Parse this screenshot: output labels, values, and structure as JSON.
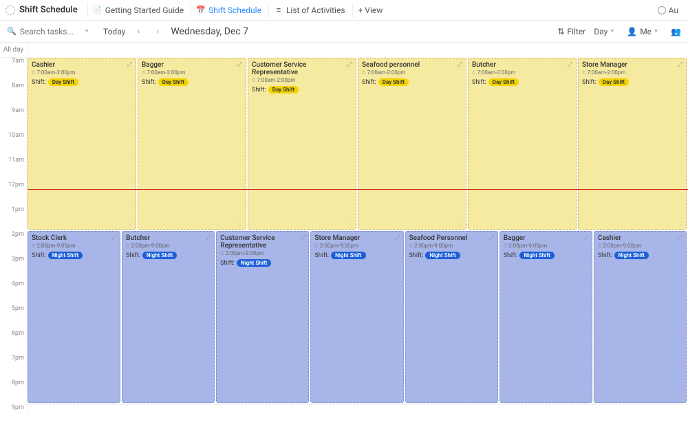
{
  "header": {
    "title": "Shift Schedule",
    "tabs": [
      {
        "label": "Getting Started Guide",
        "icon": "📄"
      },
      {
        "label": "Shift Schedule",
        "icon": "📅",
        "active": true
      },
      {
        "label": "List of Activities",
        "icon": "≡"
      }
    ],
    "addView": "+ View",
    "auBtn": "Au"
  },
  "controls": {
    "searchPlaceholder": "Search tasks...",
    "today": "Today",
    "date": "Wednesday, Dec 7",
    "filter": "Filter",
    "dayView": "Day",
    "me": "Me"
  },
  "calendar": {
    "allDay": "All day",
    "hours": [
      "7am",
      "8am",
      "9am",
      "10am",
      "11am",
      "12pm",
      "1pm",
      "2pm",
      "3pm",
      "4pm",
      "5pm",
      "6pm",
      "7pm",
      "8pm",
      "9pm"
    ],
    "startHour": 7,
    "hourHeight": 36,
    "nowHour": 12.3,
    "shiftLabel": "Shift:",
    "dayBadge": "Day Shift",
    "nightBadge": "Night Shift",
    "dayTime": "7:00am-2:00pm",
    "nightTime": "2:00pm-9:00pm",
    "dayEvents": [
      {
        "title": "Cashier"
      },
      {
        "title": "Bagger"
      },
      {
        "title": "Customer Service Representative"
      },
      {
        "title": "Seafood personnel"
      },
      {
        "title": "Butcher"
      },
      {
        "title": "Store Manager"
      }
    ],
    "nightEvents": [
      {
        "title": "Stock Clerk"
      },
      {
        "title": "Butcher"
      },
      {
        "title": "Customer Service Representative"
      },
      {
        "title": "Store Manager"
      },
      {
        "title": "Seafood Personnel"
      },
      {
        "title": "Bagger"
      },
      {
        "title": "Cashier"
      }
    ]
  }
}
